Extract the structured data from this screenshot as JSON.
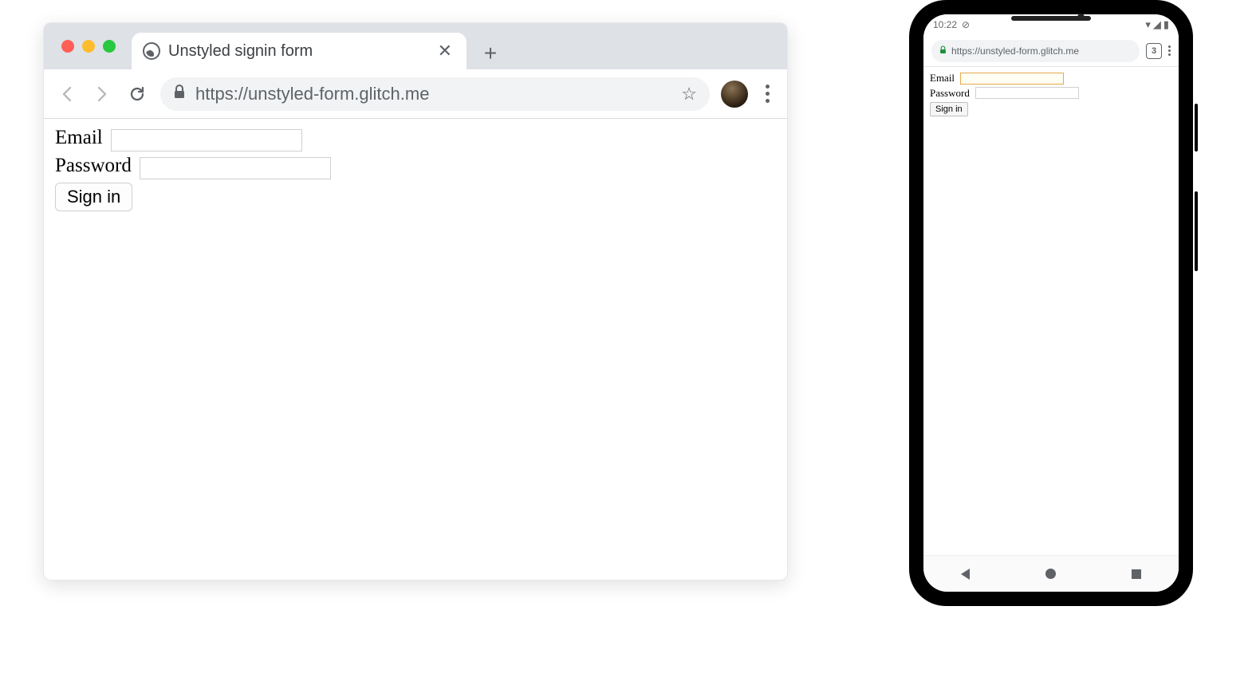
{
  "desktop": {
    "tab_title": "Unstyled signin form",
    "url": "https://unstyled-form.glitch.me",
    "form": {
      "email_label": "Email",
      "password_label": "Password",
      "submit_label": "Sign in"
    }
  },
  "phone": {
    "status": {
      "time": "10:22",
      "tabs_count": "3"
    },
    "url": "https://unstyled-form.glitch.me",
    "form": {
      "email_label": "Email",
      "password_label": "Password",
      "submit_label": "Sign in"
    }
  }
}
